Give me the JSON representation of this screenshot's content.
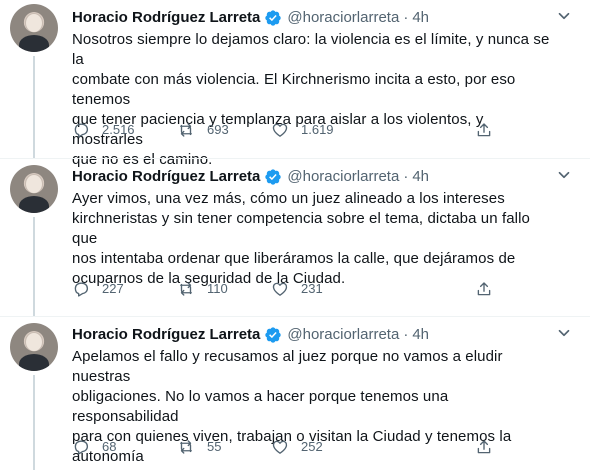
{
  "colors": {
    "primary_text": "#0f1419",
    "secondary_text": "#536471",
    "verified_blue": "#1d9bf0",
    "thread_line": "#cfd9de",
    "divider": "#eff3f4",
    "background": "#ffffff"
  },
  "icons": {
    "verified": "verified-badge-icon",
    "more": "chevron-down-icon",
    "reply": "reply-icon",
    "retweet": "retweet-icon",
    "like": "heart-icon",
    "share": "share-icon"
  },
  "tweets": [
    {
      "name": "Horacio Rodríguez Larreta",
      "handle": "@horaciorlarreta",
      "separator": "·",
      "time": "4h",
      "text": "Nosotros siempre lo dejamos claro: la violencia es el límite, y nunca se la\ncombate con más violencia. El Kirchnerismo incita a esto, por eso tenemos\nque tener paciencia y templanza para aislar a los violentos, y mostrarles\nque no es el camino.",
      "replies": "2.516",
      "retweets": "693",
      "likes": "1.619"
    },
    {
      "name": "Horacio Rodríguez Larreta",
      "handle": "@horaciorlarreta",
      "separator": "·",
      "time": "4h",
      "text": "Ayer vimos, una vez más, cómo un juez alineado a los intereses\nkirchneristas y sin tener competencia sobre el tema, dictaba un fallo que\nnos intentaba ordenar que liberáramos la calle, que dejáramos de\nocuparnos de la seguridad de la Ciudad.",
      "replies": "227",
      "retweets": "110",
      "likes": "231"
    },
    {
      "name": "Horacio Rodríguez Larreta",
      "handle": "@horaciorlarreta",
      "separator": "·",
      "time": "4h",
      "text": "Apelamos el fallo y recusamos al juez porque no vamos a eludir nuestras\nobligaciones. No lo vamos a hacer porque tenemos una responsabilidad\npara con quienes viven, trabajan o visitan la Ciudad y tenemos la autonomía\nque nos garantiza la Constitución Nacional.",
      "replies": "68",
      "retweets": "55",
      "likes": "252"
    }
  ]
}
